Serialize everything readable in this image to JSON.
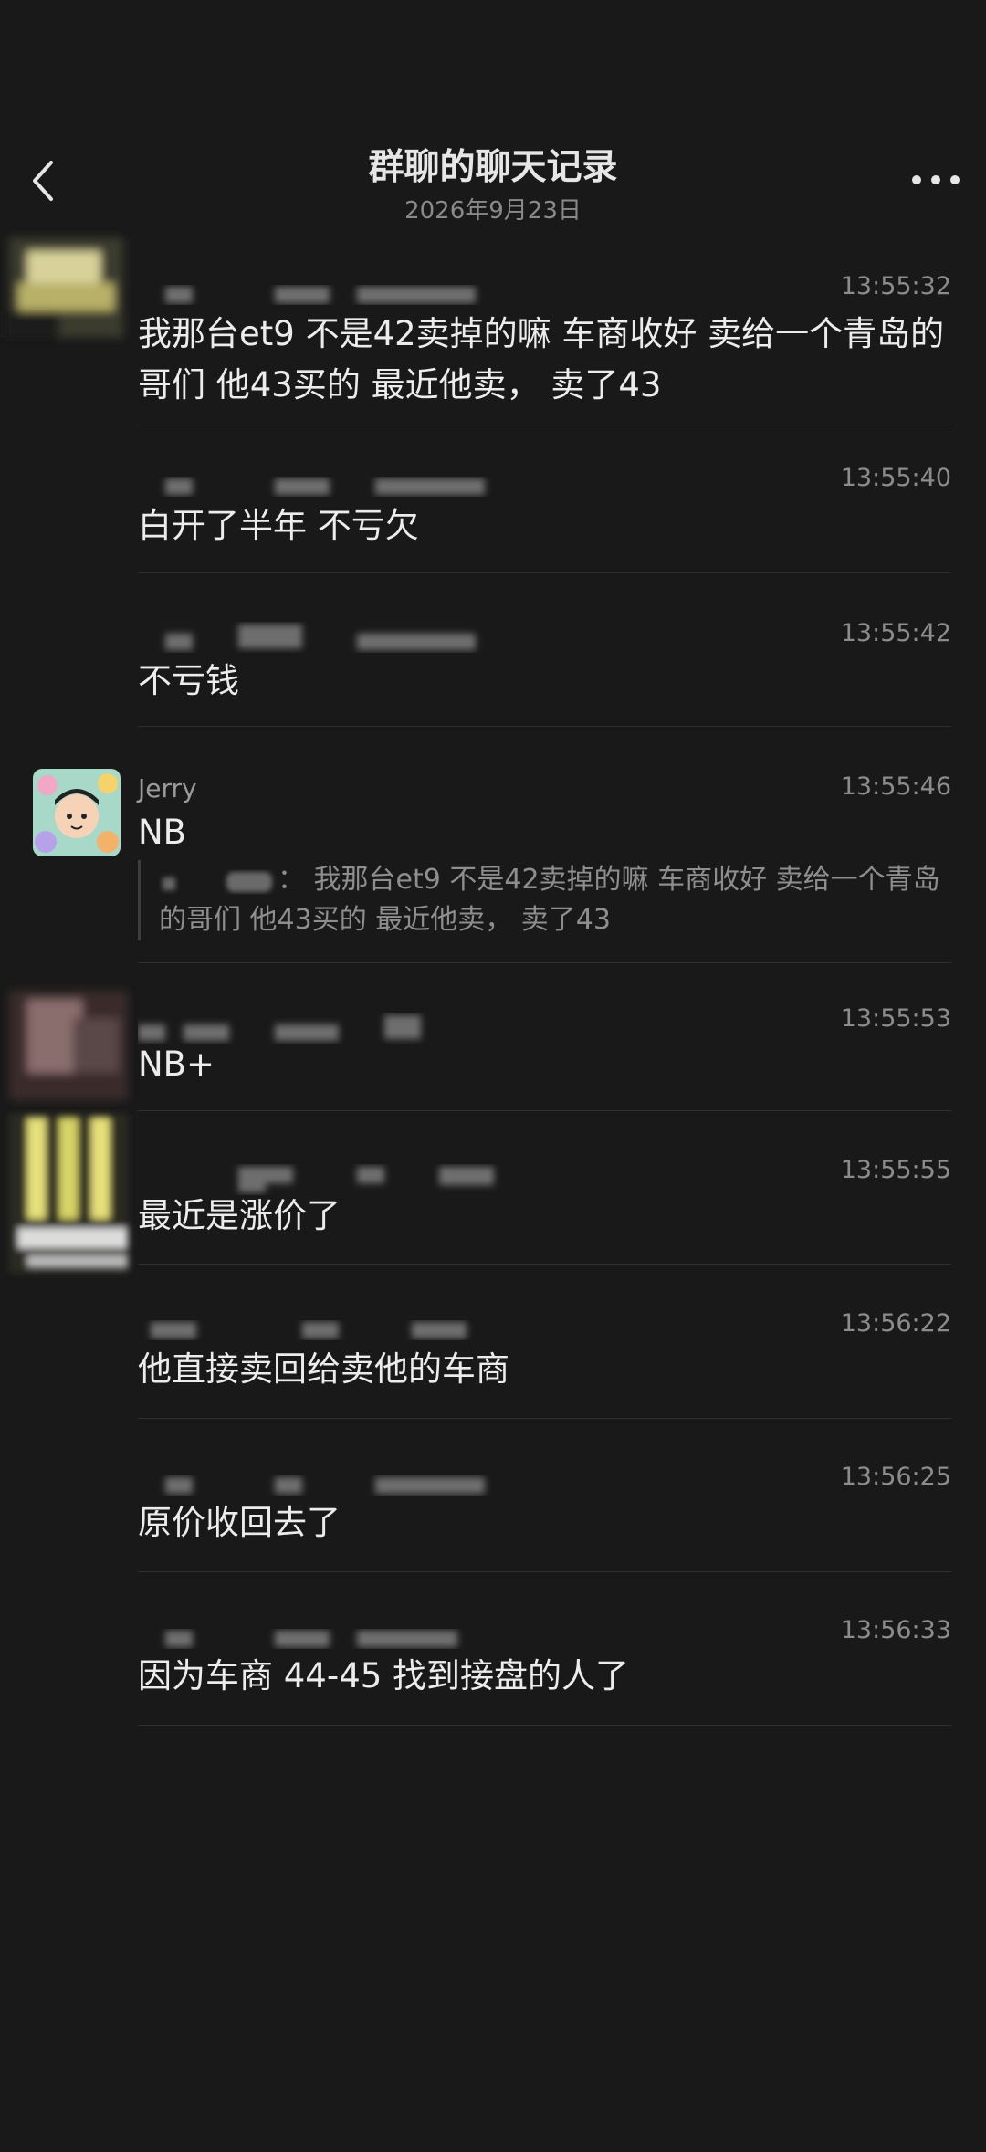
{
  "header": {
    "title": "群聊的聊天记录",
    "date": "2026年9月23日",
    "back_icon": "chevron-left-icon",
    "more_icon": "more-horizontal-icon"
  },
  "messages": [
    {
      "sender": "",
      "time": "13:55:32",
      "text": "我那台et9  不是42卖掉的嘛    车商收好  卖给一个青岛的哥们  他43买的    最近他卖，   卖了43"
    },
    {
      "sender": "",
      "time": "13:55:40",
      "text": "白开了半年    不亏欠"
    },
    {
      "sender": "",
      "time": "13:55:42",
      "text": "不亏钱"
    },
    {
      "sender": "Jerry",
      "time": "13:55:46",
      "text": "NB",
      "quote": {
        "text": "：  我那台et9  不是42卖掉的嘛    车商收好  卖给一个青岛的哥们  他43买的    最近他卖，   卖了43"
      }
    },
    {
      "sender": "",
      "time": "13:55:53",
      "text": "NB+"
    },
    {
      "sender": "",
      "time": "13:55:55",
      "text": "最近是涨价了"
    },
    {
      "sender": "",
      "time": "13:56:22",
      "text": "他直接卖回给卖他的车商"
    },
    {
      "sender": "",
      "time": "13:56:25",
      "text": "原价收回去了"
    },
    {
      "sender": "",
      "time": "13:56:33",
      "text": "因为车商 44-45  找到接盘的人了"
    }
  ]
}
